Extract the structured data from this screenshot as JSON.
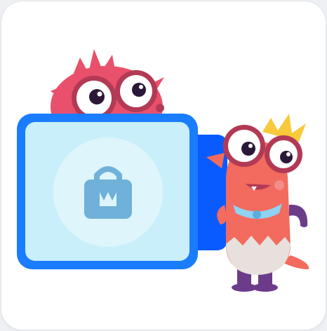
{
  "colors": {
    "card_background": "#ffffff",
    "page_background": "#eef0f3",
    "box_border": "#1a7cff",
    "box_inner": "#c9effa",
    "lock_circle": "#ddf5fb",
    "lock_icon": "#6fb1d8",
    "back_panel": "#0a5bff",
    "monster_red": "#e9506b",
    "monster_coral": "#f26b5e",
    "eye_frame": "#b23a55",
    "yellow_tuft": "#f7c93b",
    "bib": "#8fd2f2",
    "legs": "#6c3b8a"
  },
  "icons": {
    "lock": "lock-icon",
    "monster_peeking": "red-monster-peeking",
    "monster_standing": "coral-monster-standing"
  }
}
